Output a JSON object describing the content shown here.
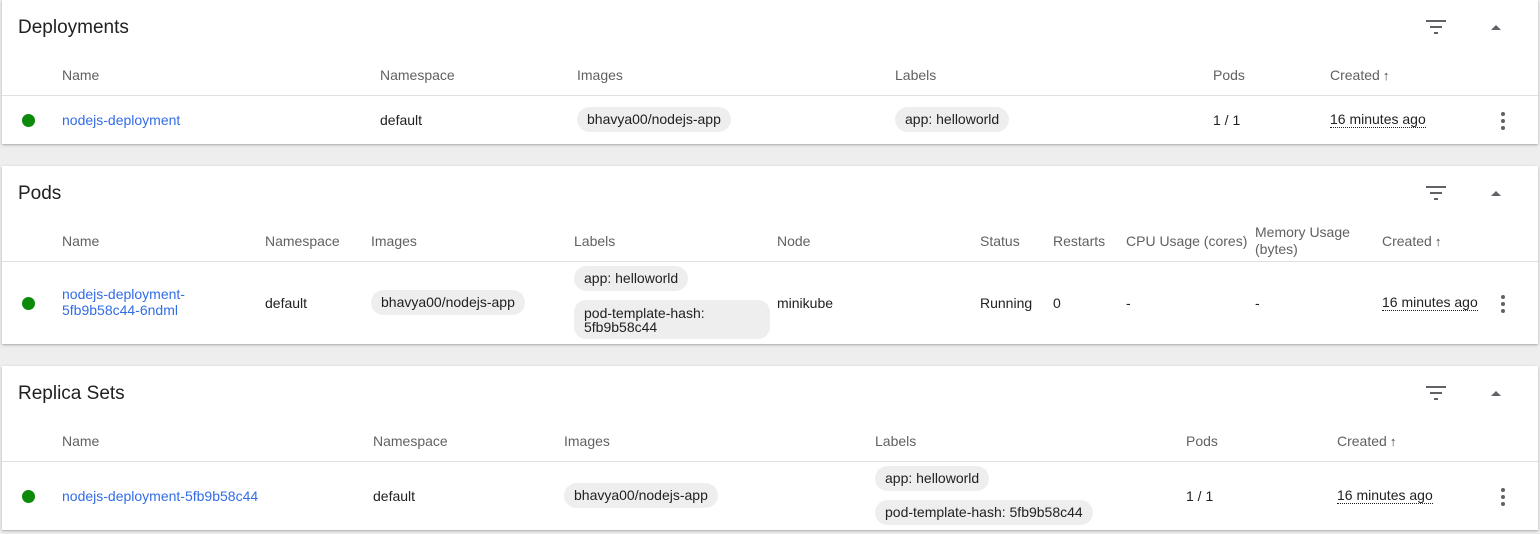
{
  "colors": {
    "status_ok": "#0b8a0b",
    "link": "#326de6"
  },
  "icons": {
    "filter": "filter-icon",
    "collapse": "chevron-up-icon",
    "more": "more-vert-icon",
    "sort": "arrow-up-icon"
  },
  "deployments": {
    "title": "Deployments",
    "headers": {
      "name": "Name",
      "namespace": "Namespace",
      "images": "Images",
      "labels": "Labels",
      "pods": "Pods",
      "created": "Created"
    },
    "rows": [
      {
        "name": "nodejs-deployment",
        "namespace": "default",
        "image": "bhavya00/nodejs-app",
        "labels": [
          "app: helloworld"
        ],
        "pods": "1 / 1",
        "created": "16 minutes ago"
      }
    ]
  },
  "pods": {
    "title": "Pods",
    "headers": {
      "name": "Name",
      "namespace": "Namespace",
      "images": "Images",
      "labels": "Labels",
      "node": "Node",
      "status": "Status",
      "restarts": "Restarts",
      "cpu": "CPU Usage (cores)",
      "memory": "Memory Usage (bytes)",
      "created": "Created"
    },
    "rows": [
      {
        "name": "nodejs-deployment-5fb9b58c44-6ndml",
        "namespace": "default",
        "image": "bhavya00/nodejs-app",
        "labels": [
          "app: helloworld",
          "pod-template-hash: 5fb9b58c44"
        ],
        "node": "minikube",
        "status": "Running",
        "restarts": "0",
        "cpu": "-",
        "memory": "-",
        "created": "16 minutes ago"
      }
    ]
  },
  "replica_sets": {
    "title": "Replica Sets",
    "headers": {
      "name": "Name",
      "namespace": "Namespace",
      "images": "Images",
      "labels": "Labels",
      "pods": "Pods",
      "created": "Created"
    },
    "rows": [
      {
        "name": "nodejs-deployment-5fb9b58c44",
        "namespace": "default",
        "image": "bhavya00/nodejs-app",
        "labels": [
          "app: helloworld",
          "pod-template-hash: 5fb9b58c44"
        ],
        "pods": "1 / 1",
        "created": "16 minutes ago"
      }
    ]
  }
}
